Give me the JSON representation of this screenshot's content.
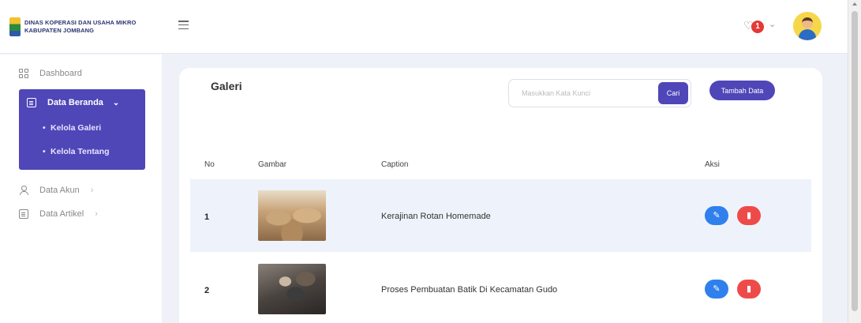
{
  "header": {
    "logo_line1": "DINAS KOPERASI DAN USAHA MIKRO",
    "logo_line2": "KABUPATEN JOMBANG",
    "notification_count": "1"
  },
  "sidebar": {
    "dashboard": "Dashboard",
    "data_beranda": "Data Beranda",
    "sub_items": [
      "Kelola Galeri",
      "Kelola Tentang"
    ],
    "data_akun": "Data Akun",
    "data_artikel": "Data Artikel"
  },
  "main": {
    "title": "Galeri",
    "search_placeholder": "Masukkan Kata Kunci",
    "search_button": "Cari",
    "add_button": "Tambah Data",
    "columns": [
      "No",
      "Gambar",
      "Caption",
      "Aksi"
    ],
    "rows": [
      {
        "no": "1",
        "image": "rattan-baskets-photo",
        "caption": "Kerajinan Rotan Homemade"
      },
      {
        "no": "2",
        "image": "batik-process-photo",
        "caption": "Proses Pembuatan Batik Di Kecamatan Gudo"
      }
    ]
  },
  "colors": {
    "accent": "#4f46b8",
    "edit": "#2f80ed",
    "delete": "#ef4a4a",
    "badge": "#e53935"
  },
  "icons": [
    "hamburger-icon",
    "bell-icon",
    "chevron-down-icon",
    "dashboard-icon",
    "document-icon",
    "user-icon",
    "pencil-icon",
    "trash-icon"
  ]
}
